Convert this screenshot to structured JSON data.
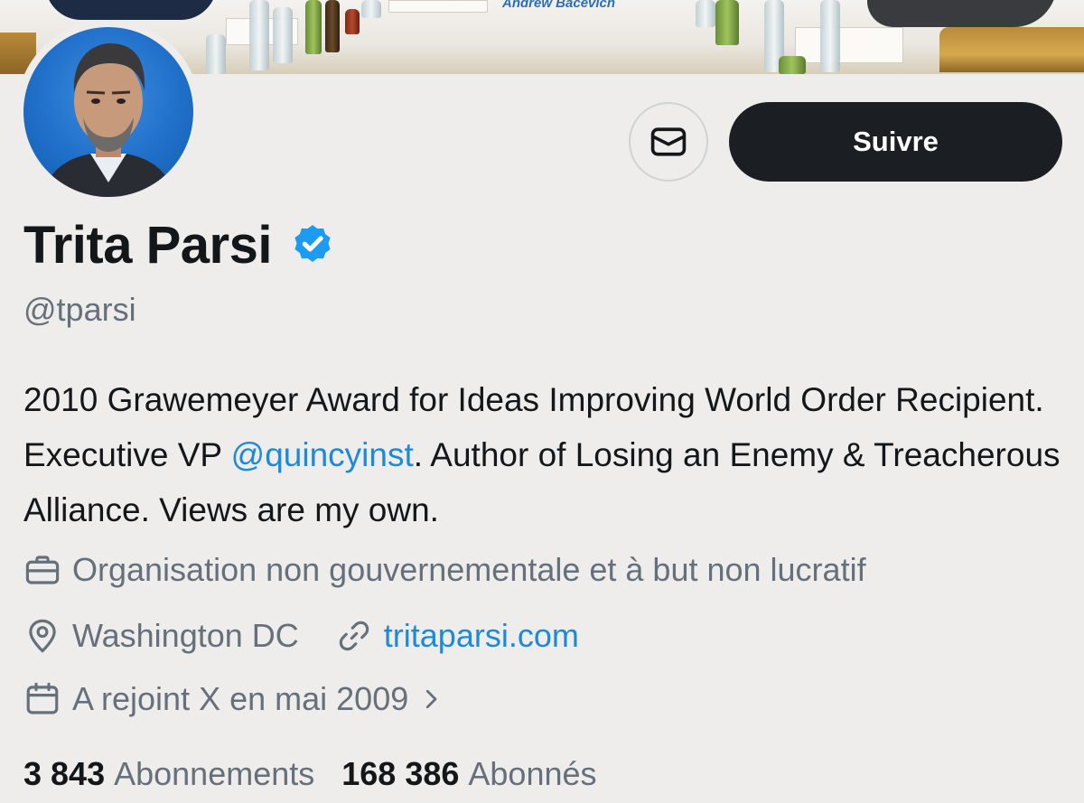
{
  "banner": {
    "caption": "Andrew Bacevich"
  },
  "profile": {
    "name": "Trita Parsi",
    "handle": "@tparsi",
    "verified": true,
    "bio": {
      "part1": "2010 Grawemeyer Award for Ideas Improving World Order Recipient. Executive VP ",
      "mention": "@quincyinst",
      "part2": ". Author of Losing an Enemy & Treacherous Alliance. Views are my own."
    },
    "category": "Organisation non gouvernementale et à but non lucratif",
    "location": "Washington DC",
    "website": "tritaparsi.com",
    "joined": "A rejoint X en mai 2009"
  },
  "actions": {
    "message_icon": "envelope-icon",
    "follow_label": "Suivre"
  },
  "stats": {
    "following_count": "3 843",
    "following_label": "Abonnements",
    "followers_count": "168 386",
    "followers_label": "Abonnés"
  },
  "colors": {
    "accent": "#1d8ad8",
    "verified": "#1d9bf0",
    "button_dark": "#1b1f23",
    "muted_text": "#66707a"
  }
}
